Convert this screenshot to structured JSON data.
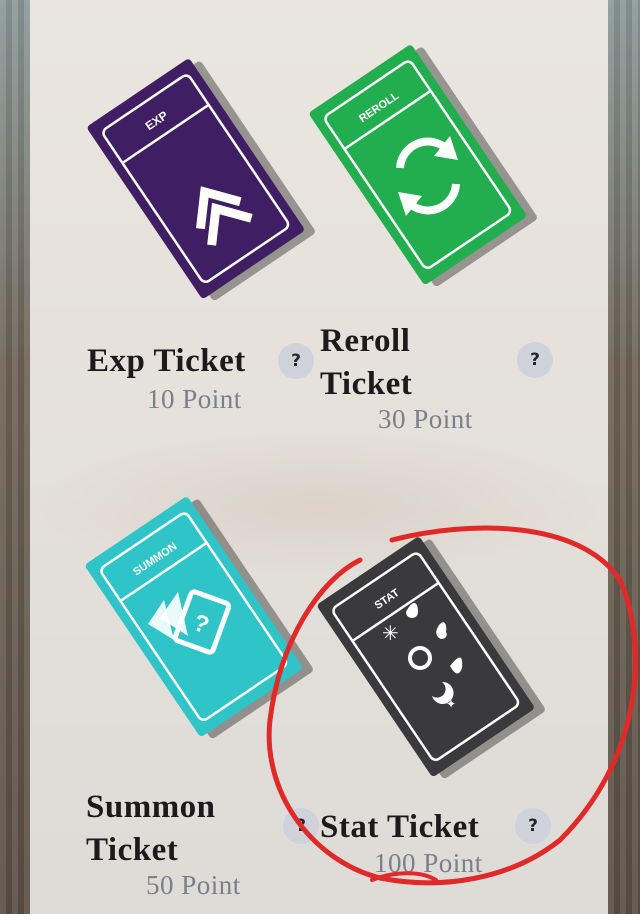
{
  "tickets": [
    {
      "id": "exp",
      "band_label": "EXP",
      "name": "Exp Ticket",
      "price": "10 Point",
      "help": "?",
      "color": "#3f1e63",
      "icon": "double-chevron-icon"
    },
    {
      "id": "reroll",
      "band_label": "REROLL",
      "name_line1": "Reroll",
      "name_line2": "Ticket",
      "price": "30 Point",
      "help": "?",
      "color": "#22ad4f",
      "icon": "refresh-arrows-icon"
    },
    {
      "id": "summon",
      "band_label": "SUMMON",
      "name_line1": "Summon",
      "name_line2": "Ticket",
      "price": "50 Point",
      "help": "?",
      "color": "#2fc4c8",
      "icon": "question-cards-icon"
    },
    {
      "id": "stat",
      "band_label": "STAT",
      "name": "Stat Ticket",
      "price": "100 Point",
      "help": "?",
      "color": "#3a3a3c",
      "icon": "elements-icon"
    }
  ],
  "annotation": {
    "color": "#e02a2a"
  }
}
